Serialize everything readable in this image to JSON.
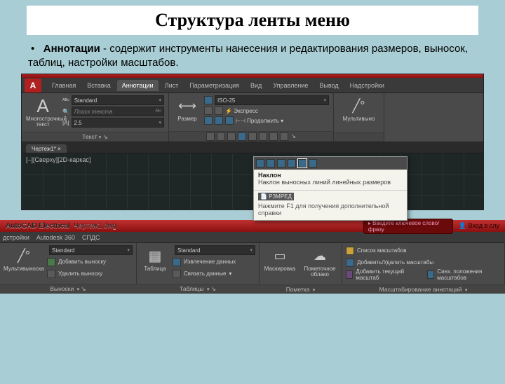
{
  "title": "Структура ленты меню",
  "desc_bold": "Аннотации",
  "desc_rest": " -   содержит инструменты нанесения и редактирования размеров, выносок, таблиц, настройки масштабов.",
  "cad1": {
    "tabs": [
      "Главная",
      "Вставка",
      "Аннотации",
      "Лист",
      "Параметризация",
      "Вид",
      "Управление",
      "Вывод",
      "Надстройки"
    ],
    "active_tab": 2,
    "text_panel": {
      "big_label": "Многострочный текст",
      "style": "Standard",
      "search": "Поиск текста",
      "height": "2.5",
      "panel_name": "Текст"
    },
    "dim_panel": {
      "big_label": "Размер",
      "style": "ISO-25",
      "express": "Экспресс",
      "continue": "Продолжить"
    },
    "leader_panel": {
      "big_label": "Мультивыно"
    },
    "doc_tab": "Чертеж1*",
    "viewport_label": "[‒][Сверху][2D-каркас]",
    "tooltip": {
      "title": "Наклон",
      "desc": "Наклон выносных линий линейных размеров",
      "cmd": "РЗМРЕД",
      "help": "Нажмите F1 для получения дополнительной справки"
    }
  },
  "cad2": {
    "app": "AutoCAD Electrical",
    "file": "Чертеж1.dwg",
    "search_ph": "Введите ключевое слово/фразу",
    "login": "Вход в слу",
    "tabs2": [
      "дстройки",
      "Autodesk 360",
      "СПДС"
    ],
    "leader": {
      "big": "Мультивыноска",
      "style": "Standard",
      "add": "Добавить выноску",
      "remove": "Удалить выноску",
      "panel": "Выноски"
    },
    "table": {
      "big": "Таблица",
      "style": "Standard",
      "extract": "Извлечение данных",
      "link": "Связать данные",
      "panel": "Таблицы"
    },
    "mark": {
      "mask": "Маскировка",
      "cloud": "Пометочное облако",
      "panel": "Пометка"
    },
    "scale": {
      "list": "Список масштабов",
      "addrem": "Добавить/Удалить масштабы",
      "addcur": "Добавить текущий масштаб",
      "sync": "Синх. положения масштабов",
      "panel": "Масштабирование аннотаций"
    }
  }
}
